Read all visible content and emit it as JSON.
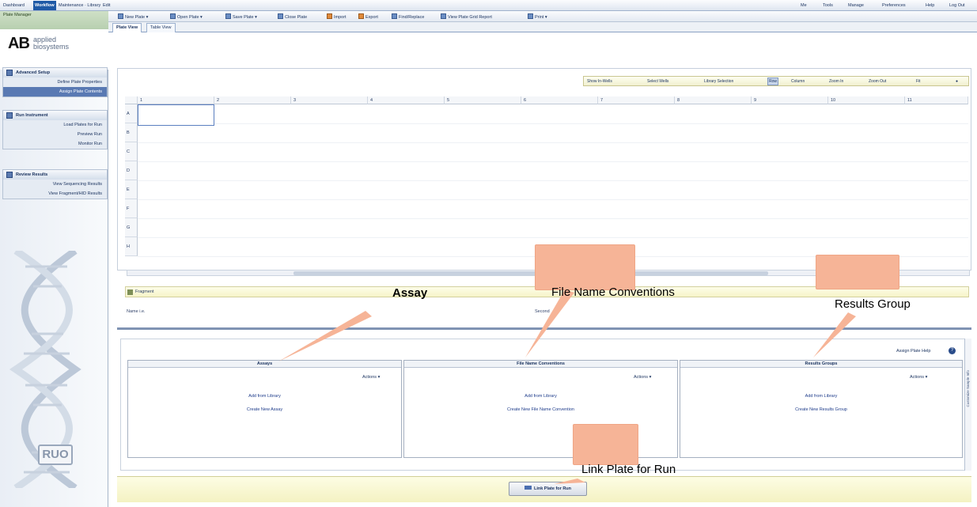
{
  "menu": {
    "items": [
      "Dashboard",
      "Workflow",
      "Maintenance · Library",
      "Edit"
    ],
    "right": [
      "Me",
      "Tools",
      "Manage",
      "Preferences",
      "Help",
      "Log Out"
    ],
    "active": "Workflow"
  },
  "app_title": "Plate Manager",
  "logo": {
    "mark": "AB",
    "line1": "applied",
    "line2": "biosystems"
  },
  "toolbar": [
    "New Plate",
    "Open Plate",
    "Save Plate",
    "Close Plate",
    "Import",
    "Export",
    "Find/Replace",
    "View Plate Grid Report",
    "Print"
  ],
  "tabs": [
    "Plate View",
    "Table View"
  ],
  "nav": {
    "sections": [
      {
        "title": "Advanced Setup",
        "items": [
          "Define Plate Properties",
          "Assign Plate Contents"
        ],
        "selected": 1
      },
      {
        "title": "Run Instrument",
        "items": [
          "Load Plates for Run",
          "Preview Run",
          "Monitor Run"
        ],
        "selected": -1
      },
      {
        "title": "Review Results",
        "items": [
          "View Sequencing Results",
          "View Fragment/HID Results"
        ],
        "selected": -1
      }
    ]
  },
  "viewbar": [
    "Show In-Wells",
    "Select Wells",
    "Library Selection",
    "Row",
    "Column",
    "Zoom In",
    "Zoom Out",
    "Fit"
  ],
  "grid": {
    "columns": [
      "1",
      "2",
      "3",
      "4",
      "5",
      "6",
      "7",
      "8",
      "9",
      "10",
      "11"
    ],
    "rows": [
      "A",
      "B",
      "C",
      "D",
      "E",
      "F",
      "G",
      "H"
    ]
  },
  "fragment_label": "Fragment",
  "meta": {
    "name_label": "Name i.e.",
    "second_label": "Second"
  },
  "panel": {
    "help_label": "Assign Plate Help",
    "boxes": [
      {
        "title": "Assays",
        "actions": "Actions",
        "link1": "Add from Library",
        "link2": "Create New Assay"
      },
      {
        "title": "File Name Conventions",
        "actions": "Actions",
        "link1": "Add from Library",
        "link2": "Create New File Name Convention"
      },
      {
        "title": "Results Groups",
        "actions": "Actions",
        "link1": "Add from Library",
        "link2": "Create New Results Group"
      }
    ],
    "side_label": "Customize Sample Info"
  },
  "link_button": "Link Plate for Run",
  "ruo": "RUO",
  "annotations": {
    "assay": "Assay",
    "file_name": "File Name Conventions",
    "results_group": "Results Group",
    "link_plate": "Link Plate for Run"
  }
}
